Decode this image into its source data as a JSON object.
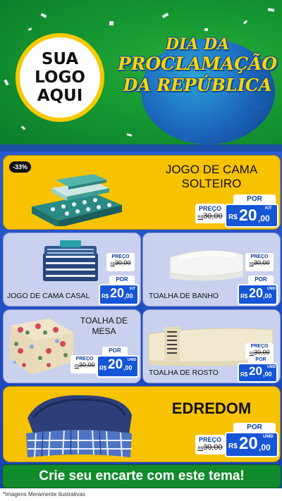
{
  "header": {
    "logo_lines": [
      "SUA",
      "LOGO",
      "AQUI"
    ],
    "title_lines": [
      "DIA DA",
      "PROCLAMAÇÃO",
      "DA REPÚBLICA"
    ]
  },
  "products": [
    {
      "name_lines": [
        "JOGO DE CAMA",
        "SOLTEIRO"
      ],
      "badge": "-33%",
      "old_label": "PREÇO",
      "old_prefix": "R$",
      "old_price": "30,00",
      "por_label": "POR",
      "currency": "R$",
      "price_int": "20",
      "price_dec": ",00",
      "unit": "KIT"
    },
    {
      "name_lines": [
        "JOGO DE CAMA CASAL"
      ],
      "old_label": "PREÇO",
      "old_prefix": "R$",
      "old_price": "30,00",
      "por_label": "POR",
      "currency": "R$",
      "price_int": "20",
      "price_dec": ",00",
      "unit": "KIT"
    },
    {
      "name_lines": [
        "TOALHA DE BANHO"
      ],
      "old_label": "PREÇO",
      "old_prefix": "R$",
      "old_price": "30,00",
      "por_label": "POR",
      "currency": "R$",
      "price_int": "20",
      "price_dec": ",00",
      "unit": "UNID"
    },
    {
      "name_lines": [
        "TOALHA DE",
        "MESA"
      ],
      "old_label": "PREÇO",
      "old_prefix": "R$",
      "old_price": "30,00",
      "por_label": "POR",
      "currency": "R$",
      "price_int": "20",
      "price_dec": ",00",
      "unit": "UNID"
    },
    {
      "name_lines": [
        "TOALHA DE ROSTO"
      ],
      "old_label": "PREÇO",
      "old_prefix": "R$",
      "old_price": "30,00",
      "por_label": "POR",
      "currency": "R$",
      "price_int": "20",
      "price_dec": ",00",
      "unit": "UNID"
    },
    {
      "name_lines": [
        "EDREDOM"
      ],
      "old_label": "PREÇO",
      "old_prefix": "R$",
      "old_price": "30,00",
      "por_label": "POR",
      "currency": "R$",
      "price_int": "20",
      "price_dec": ",00",
      "unit": "UNID"
    }
  ],
  "cta": "Crie seu encarte com este tema!",
  "footnote": "*Imagens Meramente Ilustrativas",
  "colors": {
    "green": "#0b7a2a",
    "yellow": "#f7c200",
    "blue": "#1656d6",
    "panel": "#c9d1ee"
  },
  "icons": [
    "bedding-icon",
    "towel-icon",
    "tablecloth-icon",
    "comforter-icon"
  ]
}
